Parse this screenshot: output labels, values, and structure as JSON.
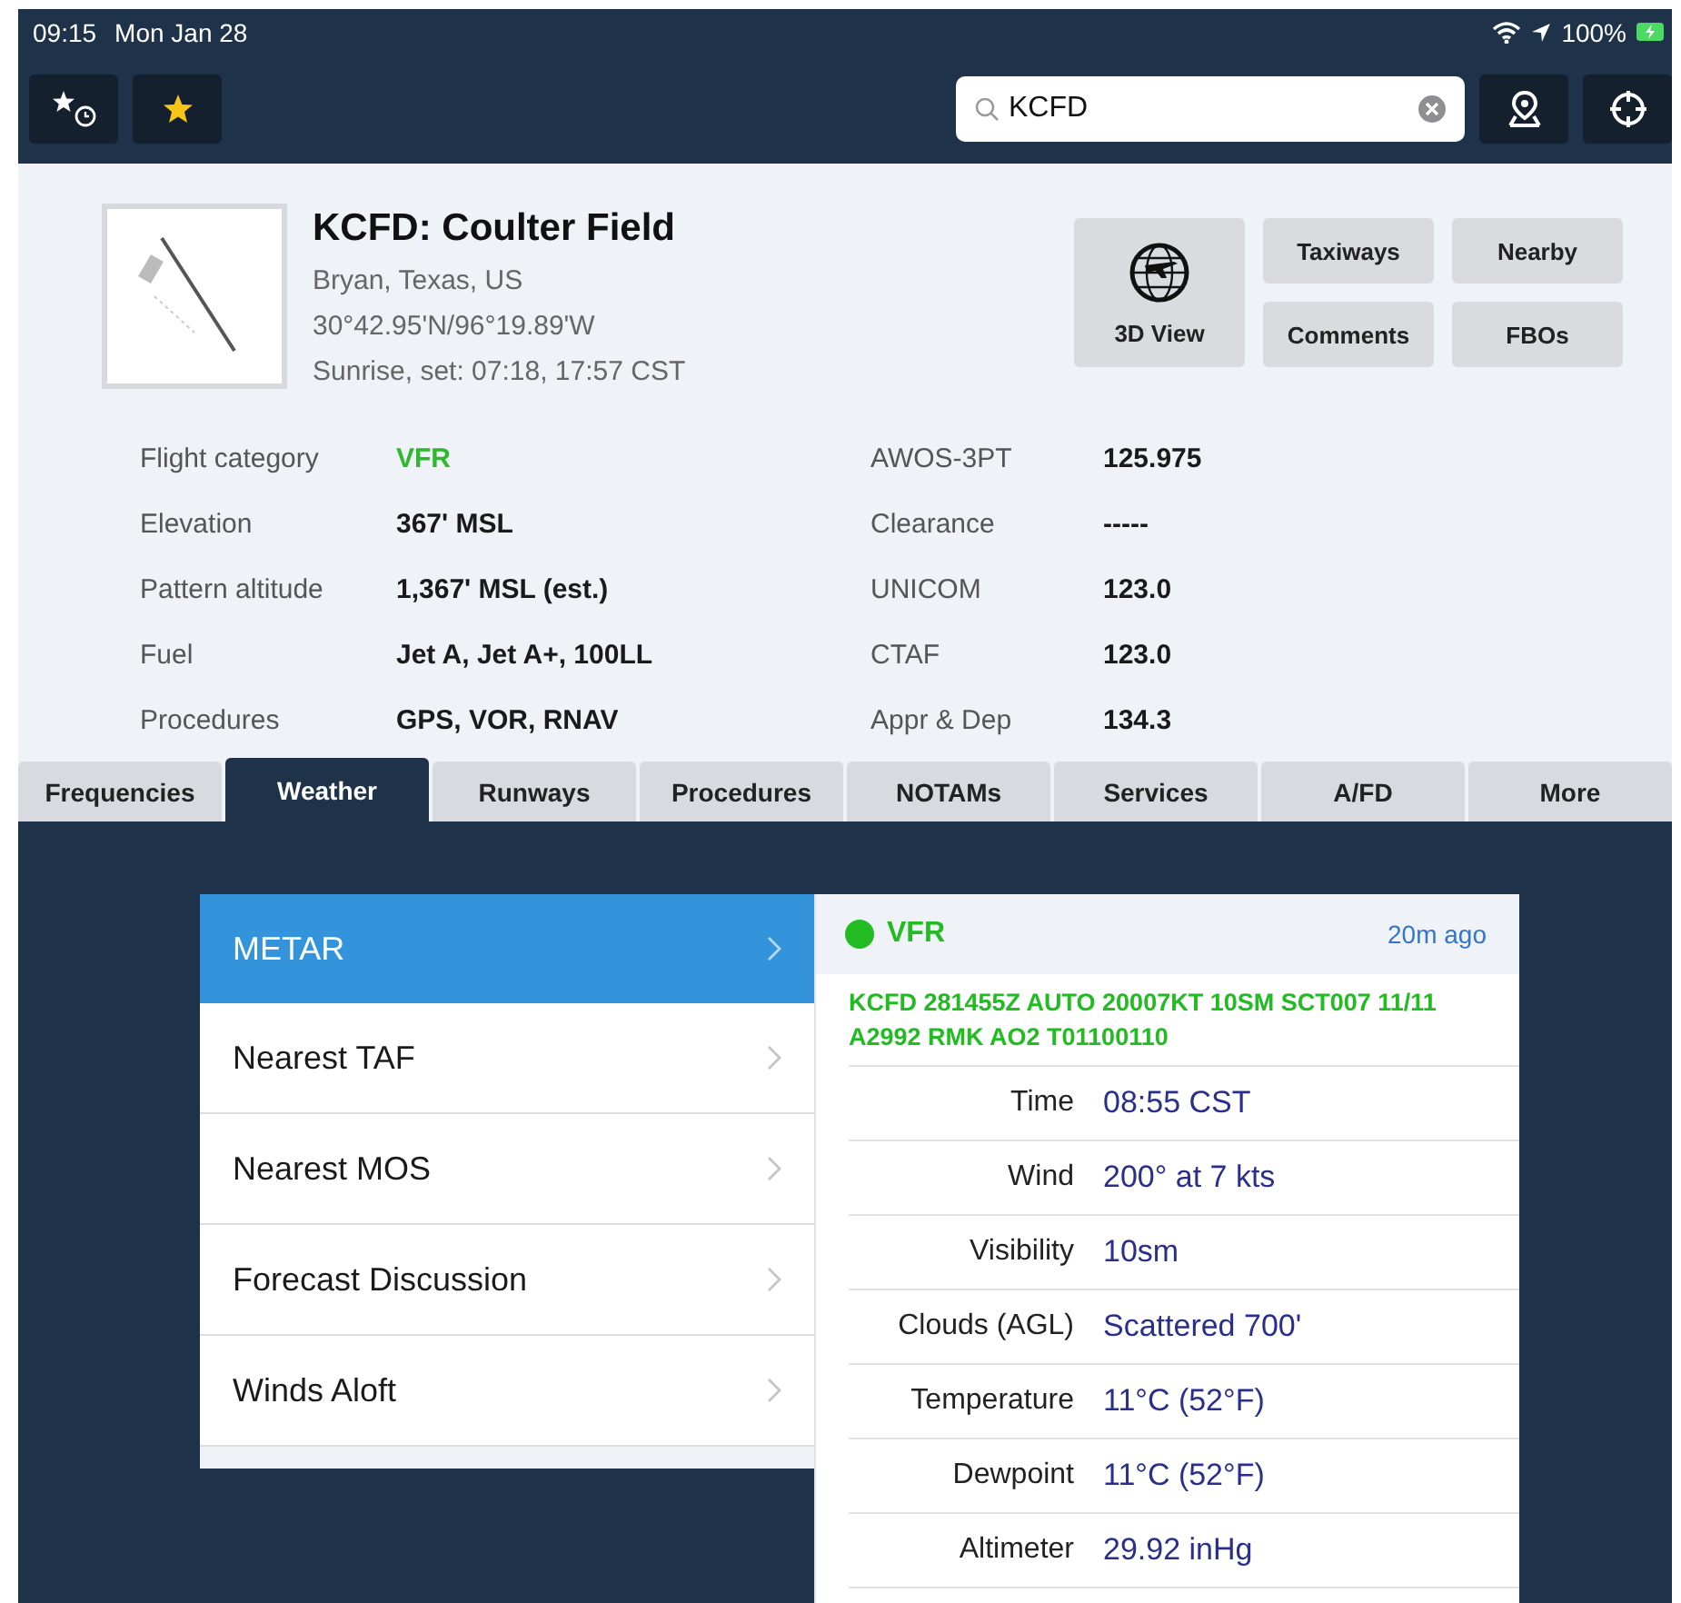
{
  "status_bar": {
    "time": "09:15",
    "date": "Mon Jan 28",
    "battery": "100%"
  },
  "toolbar": {
    "search": {
      "value": "KCFD"
    }
  },
  "airport": {
    "title": "KCFD: Coulter Field",
    "location": "Bryan, Texas, US",
    "coordinates": "30°42.95'N/96°19.89'W",
    "sun": "Sunrise, set: 07:18, 17:57 CST"
  },
  "actions": [
    {
      "label": "3D View",
      "kind": "icon"
    },
    {
      "label": "Taxiways",
      "kind": "plain"
    },
    {
      "label": "Comments",
      "kind": "plain"
    },
    {
      "label": "Nearby",
      "kind": "plain"
    },
    {
      "label": "FBOs",
      "kind": "plain"
    }
  ],
  "details_left": [
    {
      "label": "Flight category",
      "value": "VFR",
      "color": "#2db82d"
    },
    {
      "label": "Elevation",
      "value": "367' MSL"
    },
    {
      "label": "Pattern altitude",
      "value": "1,367' MSL (est.)"
    },
    {
      "label": "Fuel",
      "value": "Jet A, Jet A+, 100LL"
    },
    {
      "label": "Procedures",
      "value": "GPS, VOR, RNAV"
    }
  ],
  "details_right": [
    {
      "label": "AWOS-3PT",
      "value": "125.975"
    },
    {
      "label": "Clearance",
      "value": "-----"
    },
    {
      "label": "UNICOM",
      "value": "123.0"
    },
    {
      "label": "CTAF",
      "value": "123.0"
    },
    {
      "label": "Appr & Dep",
      "value": "134.3"
    }
  ],
  "tabs": [
    {
      "label": "Frequencies",
      "selected": false
    },
    {
      "label": "Weather",
      "selected": true
    },
    {
      "label": "Runways",
      "selected": false
    },
    {
      "label": "Procedures",
      "selected": false
    },
    {
      "label": "NOTAMs",
      "selected": false
    },
    {
      "label": "Services",
      "selected": false
    },
    {
      "label": "A/FD",
      "selected": false
    },
    {
      "label": "More",
      "selected": false
    }
  ],
  "weather_menu": [
    {
      "label": "METAR",
      "selected": true
    },
    {
      "label": "Nearest TAF",
      "selected": false
    },
    {
      "label": "Nearest MOS",
      "selected": false
    },
    {
      "label": "Forecast Discussion",
      "selected": false
    },
    {
      "label": "Winds Aloft",
      "selected": false
    }
  ],
  "metar": {
    "category": "VFR",
    "color": "#22bb22",
    "age": "20m ago",
    "raw": "KCFD 281455Z AUTO 20007KT 10SM SCT007 11/11 A2992 RMK AO2 T01100110",
    "rows": [
      {
        "label": "Time",
        "value": "08:55 CST"
      },
      {
        "label": "Wind",
        "value": "200° at 7 kts"
      },
      {
        "label": "Visibility",
        "value": "10sm"
      },
      {
        "label": "Clouds (AGL)",
        "value": "Scattered 700'"
      },
      {
        "label": "Temperature",
        "value": "11°C (52°F)"
      },
      {
        "label": "Dewpoint",
        "value": "11°C (52°F)"
      },
      {
        "label": "Altimeter",
        "value": "29.92 inHg"
      }
    ]
  }
}
